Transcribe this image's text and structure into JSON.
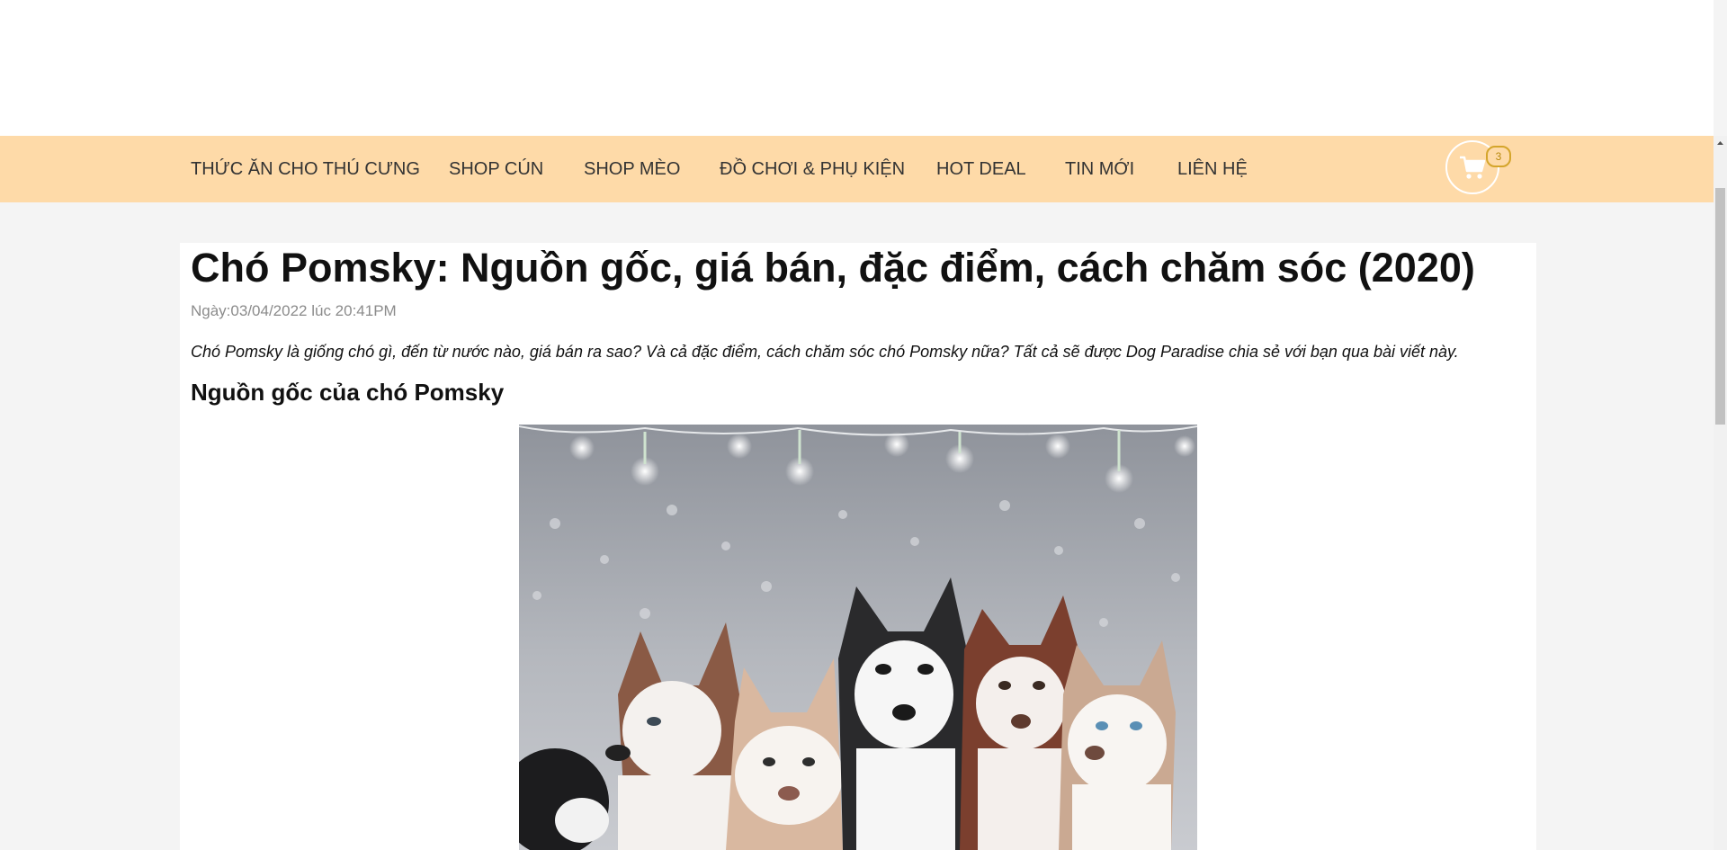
{
  "nav": {
    "items": [
      {
        "label": "THỨC ĂN CHO THÚ CƯNG"
      },
      {
        "label": "SHOP CÚN"
      },
      {
        "label": "SHOP MÈO"
      },
      {
        "label": "ĐỒ CHƠI & PHỤ KIỆN"
      },
      {
        "label": "HOT DEAL"
      },
      {
        "label": "TIN MỚI"
      },
      {
        "label": "LIÊN HỆ"
      }
    ],
    "cart_icon": "cart-icon",
    "cart_count": "3"
  },
  "article": {
    "title": "Chó Pomsky: Nguồn gốc, giá bán, đặc điểm, cách chăm sóc (2020)",
    "date": "Ngày:03/04/2022 lúc 20:41PM",
    "intro": "Chó Pomsky là giống chó gì, đến từ nước nào, giá bán ra sao? Và cả đặc điểm, cách chăm sóc chó Pomsky nữa? Tất cả sẽ được Dog Paradise chia sẻ với bạn qua bài viết này.",
    "section_heading": "Nguồn gốc của chó Pomsky"
  },
  "colors": {
    "nav_bg": "#fedaa8",
    "page_bg": "#f4f4f4",
    "badge": "#d4a52b"
  }
}
